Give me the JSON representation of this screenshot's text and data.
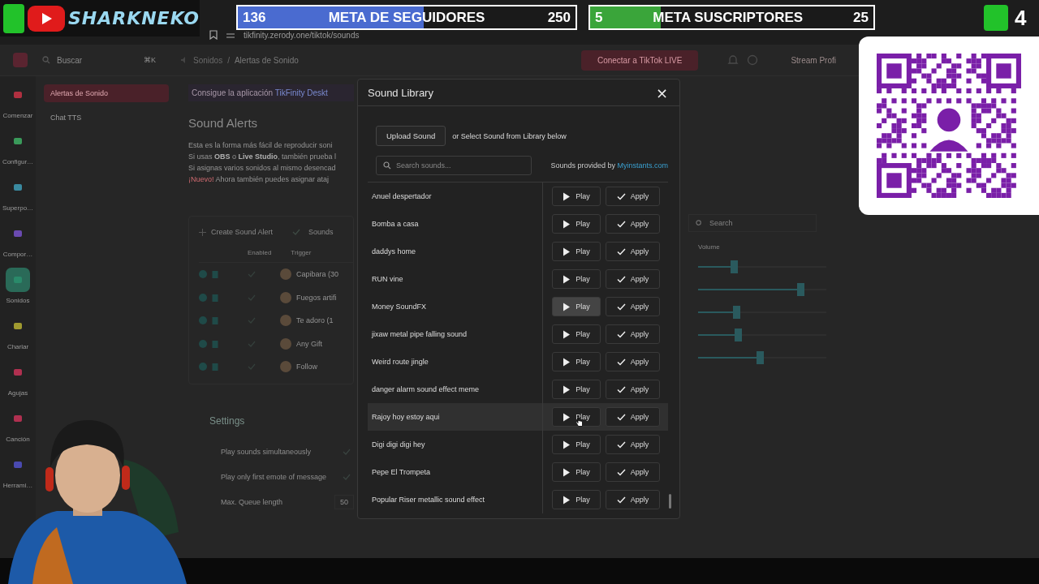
{
  "stream_overlay": {
    "channel_name": "SHARKNEKO",
    "goals": [
      {
        "current": "136",
        "title": "META DE SEGUIDORES",
        "target": "250",
        "level": 0.55,
        "color": "#4a6bd0"
      },
      {
        "current": "5",
        "title": "META SUSCRIPTORES",
        "target": "25",
        "level": 0.25,
        "color": "#3aa53a"
      }
    ],
    "counter": "4"
  },
  "browser": {
    "url": "tikfinity.zerody.one/tiktok/sounds"
  },
  "header": {
    "search_placeholder": "Buscar",
    "shortcut": "⌘K",
    "breadcrumb": [
      "Sonidos",
      "/",
      "Alertas de Sonido"
    ],
    "connect_button": "Conectar a TikTok LIVE",
    "profile": "Stream Profi"
  },
  "nav": [
    {
      "label": "Comenzar",
      "selected": false,
      "color": "#b03040"
    },
    {
      "label": "Configur…",
      "selected": false,
      "color": "#3a9a5a"
    },
    {
      "label": "Superpo…",
      "selected": false,
      "color": "#3a8aa0"
    },
    {
      "label": "Compor…",
      "selected": false,
      "color": "#6a4ab0"
    },
    {
      "label": "Sonidos",
      "selected": true,
      "color": "#2a8a6a"
    },
    {
      "label": "Charlar",
      "selected": false,
      "color": "#a09a30"
    },
    {
      "label": "Agujas",
      "selected": false,
      "color": "#b03050"
    },
    {
      "label": "Canción",
      "selected": false,
      "color": "#b03050"
    },
    {
      "label": "Herrami…",
      "selected": false,
      "color": "#4a4ab0"
    }
  ],
  "subnav": [
    {
      "label": "Alertas de Sonido",
      "selected": true
    },
    {
      "label": "Chat TTS",
      "selected": false
    }
  ],
  "banner": {
    "text": "Consigue la aplicación",
    "link": "TikFinity Deskt"
  },
  "page": {
    "title": "Sound Alerts",
    "paragraphs": [
      {
        "text": "Esta es la forma más fácil de reproducir soni"
      },
      {
        "text": "Si usas **OBS** o **Live Studio**, también prueba l"
      },
      {
        "text": "Si asignas varios sonidos al mismo desencad"
      },
      {
        "badge": "¡Nuevo!",
        "text": "Ahora también puedes asignar ataj"
      }
    ]
  },
  "toolbar": {
    "create_button": "Create Sound Alert",
    "option": "Sounds"
  },
  "table": {
    "columns": [
      "Enabled",
      "Trigger"
    ],
    "search_placeholder": "Search",
    "volume_column": "Volume",
    "rows": [
      {
        "enabled": true,
        "trigger": "Capibara (30",
        "level": 0.28
      },
      {
        "enabled": true,
        "trigger": "Fuegos artifi",
        "level": 0.8
      },
      {
        "enabled": true,
        "trigger": "Te adoro (1",
        "level": 0.3
      },
      {
        "enabled": true,
        "trigger": "Any Gift",
        "level": 0.31
      },
      {
        "enabled": true,
        "trigger": "Follow",
        "level": 0.48
      }
    ]
  },
  "settings": {
    "title": "Settings",
    "rows": [
      {
        "kind": "check",
        "label": "Play sounds simultaneously",
        "checked": true
      },
      {
        "kind": "check",
        "label": "Play only first emote of message",
        "checked": true
      },
      {
        "kind": "number",
        "label": "Max. Queue length",
        "value": "50"
      }
    ]
  },
  "modal": {
    "title": "Sound Library",
    "close": "×",
    "upload_button": "Upload Sound",
    "upload_hint": "or Select Sound from Library below",
    "search_placeholder": "Search sounds...",
    "provider_text": "Sounds provided by",
    "provider_link": "Myinstants.com",
    "sounds": [
      {
        "name": "Anuel despertador",
        "hovered": false,
        "play": "Play",
        "play_hovered": false,
        "apply": "Apply"
      },
      {
        "name": "Bomba a casa",
        "hovered": false,
        "play": "Play",
        "play_hovered": false,
        "apply": "Apply"
      },
      {
        "name": "daddys home",
        "hovered": false,
        "play": "Play",
        "play_hovered": false,
        "apply": "Apply"
      },
      {
        "name": "RUN vine",
        "hovered": false,
        "play": "Play",
        "play_hovered": false,
        "apply": "Apply"
      },
      {
        "name": "Money SoundFX",
        "hovered": false,
        "play": "Play",
        "play_hovered": true,
        "apply": "Apply"
      },
      {
        "name": "jixaw metal pipe falling sound",
        "hovered": false,
        "play": "Play",
        "play_hovered": false,
        "apply": "Apply"
      },
      {
        "name": "Weird route jingle",
        "hovered": false,
        "play": "Play",
        "play_hovered": false,
        "apply": "Apply"
      },
      {
        "name": "danger alarm sound effect meme",
        "hovered": false,
        "play": "Play",
        "play_hovered": false,
        "apply": "Apply"
      },
      {
        "name": "Rajoy hoy estoy aqui",
        "hovered": true,
        "play": "Play",
        "play_hovered": false,
        "apply": "Apply"
      },
      {
        "name": "Digi digi digi hey",
        "hovered": false,
        "play": "Play",
        "play_hovered": false,
        "apply": "Apply"
      },
      {
        "name": "Pepe El Trompeta",
        "hovered": false,
        "play": "Play",
        "play_hovered": false,
        "apply": "Apply"
      },
      {
        "name": "Popular Riser metallic sound effect",
        "hovered": false,
        "play": "Play",
        "play_hovered": false,
        "apply": "Apply"
      }
    ]
  }
}
